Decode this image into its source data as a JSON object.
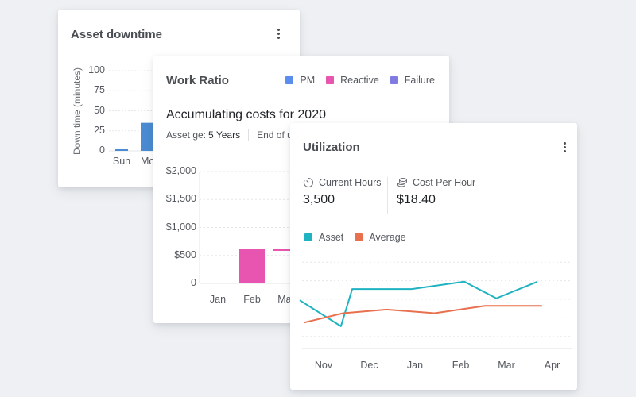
{
  "cards": {
    "downtime": {
      "title": "Asset downtime",
      "menu_icon": "kebab-vertical-icon",
      "chart_data": {
        "type": "bar",
        "title": "Asset downtime",
        "ylabel": "Down time (minutes)",
        "xlabel": "",
        "categories": [
          "Sun",
          "Mon"
        ],
        "values": [
          2,
          35
        ],
        "yticks": [
          "100",
          "75",
          "50",
          "25",
          "0"
        ],
        "ylim": [
          0,
          100
        ],
        "grid": true,
        "bar_color": "#4a8bd1"
      }
    },
    "work_ratio": {
      "title": "Work Ratio",
      "legend": [
        {
          "label": "PM",
          "color": "#5b8def"
        },
        {
          "label": "Reactive",
          "color": "#e855b0"
        },
        {
          "label": "Failure",
          "color": "#7f7be0"
        }
      ],
      "subtitle": "Accumulating costs for 2020",
      "meta": {
        "asset_age_label": "Asset ge:",
        "asset_age_value": "5 Years",
        "end_label": "End of u"
      },
      "chart_data": {
        "type": "bar",
        "title": "Accumulating costs for 2020",
        "categories": [
          "Jan",
          "Feb",
          "Mar"
        ],
        "series": [
          {
            "name": "Reactive",
            "values": [
              0,
              610,
              20
            ],
            "base": [
              0,
              0,
              590
            ]
          }
        ],
        "yticks": [
          "$2,000",
          "$1,500",
          "$1,000",
          "$500",
          "0"
        ],
        "ylim": [
          0,
          2000
        ],
        "grid": true
      }
    },
    "utilization": {
      "title": "Utilization",
      "menu_icon": "kebab-vertical-icon",
      "stats": [
        {
          "icon": "timer-icon",
          "label": "Current Hours",
          "value": "3,500"
        },
        {
          "icon": "coins-icon",
          "label": "Cost Per Hour",
          "value": "$18.40"
        }
      ],
      "legend": [
        {
          "label": "Asset",
          "color": "#1fb3c2"
        },
        {
          "label": "Average",
          "color": "#e8704f"
        }
      ],
      "chart_data": {
        "type": "line",
        "categories": [
          "Nov",
          "Dec",
          "Jan",
          "Feb",
          "Mar",
          "Apr"
        ],
        "series": [
          {
            "name": "Asset",
            "color": "#1fb3c2",
            "points": [
              [
                0,
                2.6
              ],
              [
                0.9,
                1.2
              ],
              [
                1.15,
                3.2
              ],
              [
                2.45,
                3.2
              ],
              [
                3.6,
                3.6
              ],
              [
                4.3,
                2.7
              ],
              [
                5.2,
                3.6
              ]
            ]
          },
          {
            "name": "Average",
            "color": "#e8704f",
            "points": [
              [
                0.1,
                1.4
              ],
              [
                0.95,
                1.9
              ],
              [
                1.9,
                2.1
              ],
              [
                2.95,
                1.9
              ],
              [
                4.05,
                2.3
              ],
              [
                5.3,
                2.3
              ]
            ]
          }
        ],
        "ylim": [
          0,
          5
        ],
        "grid": true,
        "ytick_labels_visible": false
      }
    }
  }
}
